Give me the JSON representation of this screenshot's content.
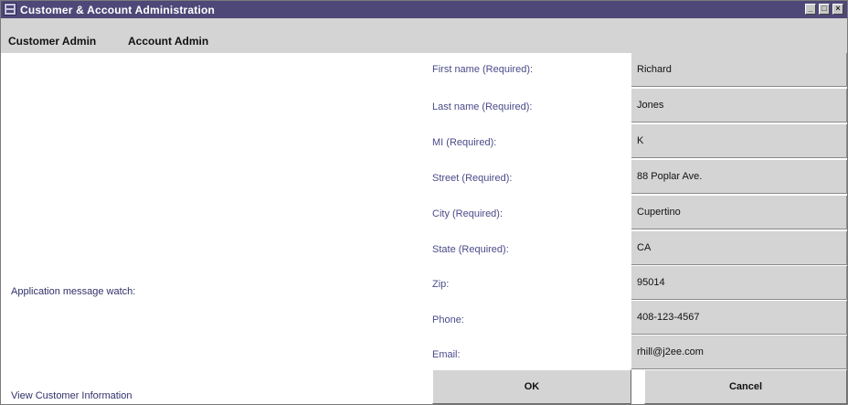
{
  "window": {
    "title": "Customer & Account Administration"
  },
  "menu": {
    "items": [
      "Customer Admin",
      "Account Admin"
    ]
  },
  "left": {
    "message_label": "Application message watch:",
    "view_link": "View Customer Information"
  },
  "form": {
    "fields": [
      {
        "label": "First name (Required):",
        "value": "Richard"
      },
      {
        "label": "Last name (Required):",
        "value": "Jones"
      },
      {
        "label": "MI (Required):",
        "value": "K"
      },
      {
        "label": "Street (Required):",
        "value": "88 Poplar Ave."
      },
      {
        "label": "City (Required):",
        "value": "Cupertino"
      },
      {
        "label": "State (Required):",
        "value": "CA"
      },
      {
        "label": "Zip:",
        "value": "95014"
      },
      {
        "label": "Phone:",
        "value": "408-123-4567"
      },
      {
        "label": "Email:",
        "value": "rhill@j2ee.com"
      }
    ]
  },
  "buttons": {
    "ok": "OK",
    "cancel": "Cancel"
  },
  "colors": {
    "titlebar": "#4e4878",
    "panel": "#d4d4d4",
    "label_text": "#4a4a8a"
  }
}
